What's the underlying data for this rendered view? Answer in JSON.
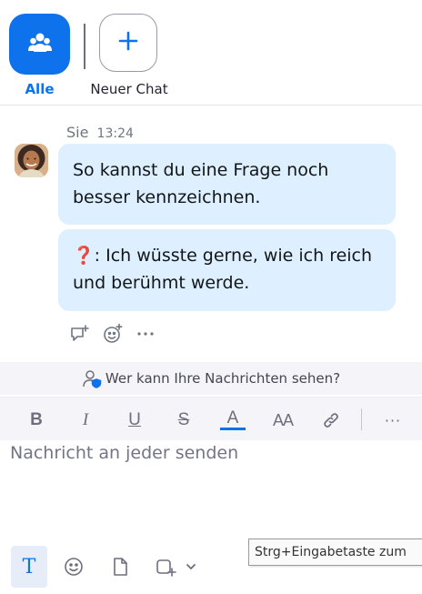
{
  "tabs": {
    "all_label": "Alle",
    "new_chat_label": "Neuer Chat"
  },
  "message": {
    "sender": "Sie",
    "time": "13:24",
    "bubble1": "So kannst du eine Frage noch besser kennzeichnen.",
    "bubble2_emoji": "❓",
    "bubble2_text": ": Ich wüsste gerne, wie ich reich und berühmt werde."
  },
  "info": {
    "visibility_text": "Wer kann Ihre Nachrichten sehen?"
  },
  "format_toolbar": {
    "bold": "B",
    "italic": "I",
    "underline": "U",
    "strike": "S",
    "font_color": "A",
    "font_size": "AA",
    "more": "···"
  },
  "compose": {
    "placeholder": "Nachricht an jeder senden"
  },
  "bottom_toolbar": {
    "text_format_label": "T"
  },
  "tooltip": {
    "text": "Strg+Eingabetaste zum"
  },
  "colors": {
    "accent": "#0e72ed",
    "bubble": "#deefff",
    "toolbar_bg": "#f5f5f9"
  }
}
